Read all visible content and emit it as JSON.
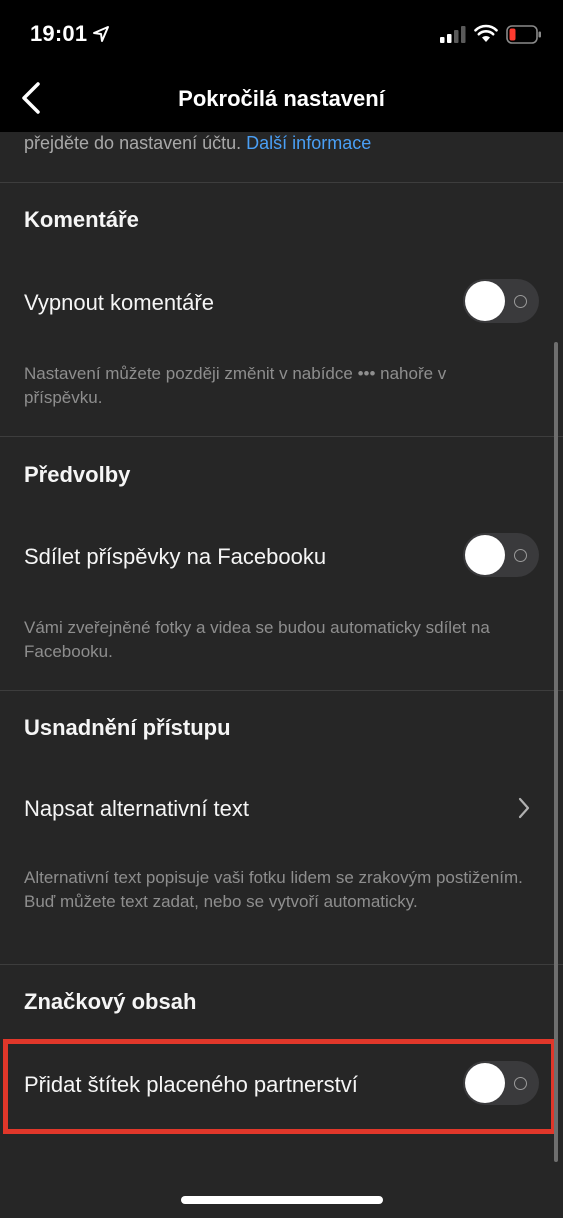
{
  "status_bar": {
    "time": "19:01",
    "icons": [
      "location-arrow-icon",
      "cellular-signal-icon",
      "wifi-icon",
      "battery-low-icon"
    ]
  },
  "nav": {
    "title": "Pokročilá nastavení",
    "back_icon": "chevron-left-icon"
  },
  "top_note": {
    "text": "přejděte do nastavení účtu.",
    "link": "Další informace"
  },
  "sections": {
    "comments": {
      "title": "Komentáře",
      "row_label": "Vypnout komentáře",
      "toggle_on": false,
      "note": "Nastavení můžete později změnit v nabídce ••• nahoře v příspěvku."
    },
    "preferences": {
      "title": "Předvolby",
      "row_label": "Sdílet příspěvky na Facebooku",
      "toggle_on": false,
      "note": "Vámi zveřejněné fotky a videa se budou automaticky sdílet na Facebooku."
    },
    "accessibility": {
      "title": "Usnadnění přístupu",
      "row_label": "Napsat alternativní text",
      "note": "Alternativní text popisuje vaši fotku lidem se zrakovým postižením. Buď můžete text zadat, nebo se vytvoří automaticky."
    },
    "branded": {
      "title": "Značkový obsah",
      "row_label": "Přidat štítek placeného partnerství",
      "toggle_on": false
    }
  },
  "colors": {
    "background": "#262626",
    "bar_background": "#000000",
    "link": "#4a9ff5",
    "highlight": "#e0372a",
    "toggle_track": "#3a3a3c"
  }
}
